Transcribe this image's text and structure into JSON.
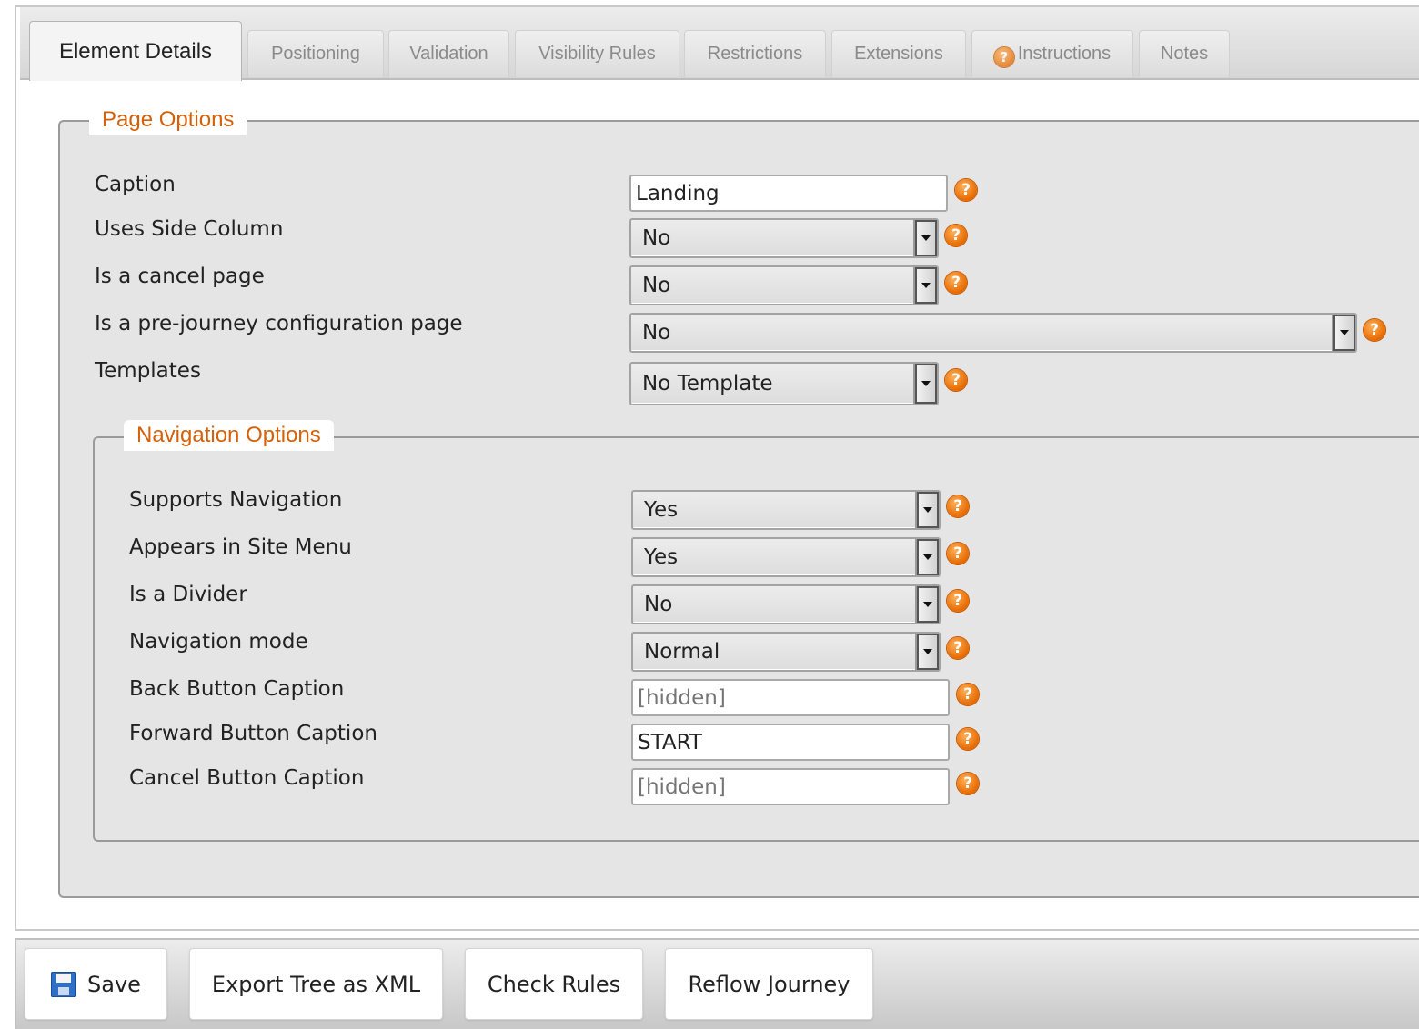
{
  "tabs": [
    {
      "label": "Element Details",
      "active": true,
      "icon": null
    },
    {
      "label": "Positioning",
      "active": false,
      "icon": null
    },
    {
      "label": "Validation",
      "active": false,
      "icon": null
    },
    {
      "label": "Visibility Rules",
      "active": false,
      "icon": null
    },
    {
      "label": "Restrictions",
      "active": false,
      "icon": null
    },
    {
      "label": "Extensions",
      "active": false,
      "icon": null
    },
    {
      "label": "Instructions",
      "active": false,
      "icon": "help-icon"
    },
    {
      "label": "Notes",
      "active": false,
      "icon": null
    }
  ],
  "page_options": {
    "legend": "Page Options",
    "fields": {
      "caption": {
        "label": "Caption",
        "value": "Landing"
      },
      "uses_side_column": {
        "label": "Uses Side Column",
        "value": "No"
      },
      "is_cancel_page": {
        "label": "Is a cancel page",
        "value": "No"
      },
      "is_pre_journey": {
        "label": "Is a pre-journey configuration page",
        "value": "No"
      },
      "templates": {
        "label": "Templates",
        "value": "No Template"
      }
    }
  },
  "navigation_options": {
    "legend": "Navigation Options",
    "fields": {
      "supports_navigation": {
        "label": "Supports Navigation",
        "value": "Yes"
      },
      "appears_in_site_menu": {
        "label": "Appears in Site Menu",
        "value": "Yes"
      },
      "is_divider": {
        "label": "Is a Divider",
        "value": "No"
      },
      "navigation_mode": {
        "label": "Navigation mode",
        "value": "Normal"
      },
      "back_button_caption": {
        "label": "Back Button Caption",
        "value": "",
        "placeholder": "[hidden]"
      },
      "forward_button_caption": {
        "label": "Forward Button Caption",
        "value": "START"
      },
      "cancel_button_caption": {
        "label": "Cancel Button Caption",
        "value": "",
        "placeholder": "[hidden]"
      }
    }
  },
  "help_glyph": "?",
  "toolbar": {
    "save_label": "Save",
    "export_label": "Export Tree as XML",
    "check_rules_label": "Check Rules",
    "reflow_label": "Reflow Journey"
  },
  "colors": {
    "accent_orange": "#d4610a",
    "help_icon": "#e66a00",
    "panel_bg": "#e5e5e5"
  }
}
